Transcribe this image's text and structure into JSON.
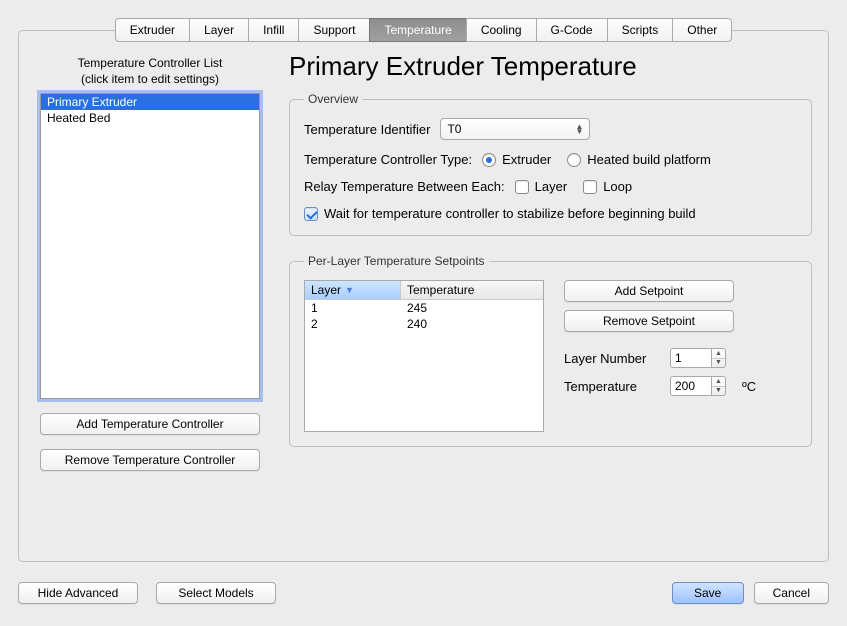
{
  "tabs": [
    "Extruder",
    "Layer",
    "Infill",
    "Support",
    "Temperature",
    "Cooling",
    "G-Code",
    "Scripts",
    "Other"
  ],
  "active_tab_index": 4,
  "left": {
    "header_line1": "Temperature Controller List",
    "header_line2": "(click item to edit settings)",
    "items": [
      "Primary Extruder",
      "Heated Bed"
    ],
    "selected_index": 0,
    "add_btn": "Add Temperature Controller",
    "remove_btn": "Remove Temperature Controller"
  },
  "title": "Primary Extruder Temperature",
  "overview": {
    "legend": "Overview",
    "identifier_label": "Temperature Identifier",
    "identifier_value": "T0",
    "type_label": "Temperature Controller Type:",
    "type_options": {
      "extruder": "Extruder",
      "heated_bed": "Heated build platform"
    },
    "type_selected": "extruder",
    "relay_label": "Relay Temperature Between Each:",
    "relay_layer_label": "Layer",
    "relay_layer_checked": false,
    "relay_loop_label": "Loop",
    "relay_loop_checked": false,
    "wait_label": "Wait for temperature controller to stabilize before beginning build",
    "wait_checked": true
  },
  "per_layer": {
    "legend": "Per-Layer Temperature Setpoints",
    "columns": {
      "layer": "Layer",
      "temp": "Temperature"
    },
    "rows": [
      {
        "layer": "1",
        "temp": "245"
      },
      {
        "layer": "2",
        "temp": "240"
      }
    ],
    "add_btn": "Add Setpoint",
    "remove_btn": "Remove Setpoint",
    "layer_num_label": "Layer Number",
    "layer_num_value": "1",
    "temp_label": "Temperature",
    "temp_value": "200",
    "temp_unit": "ºC"
  },
  "footer": {
    "hide": "Hide Advanced",
    "select": "Select Models",
    "save": "Save",
    "cancel": "Cancel"
  }
}
